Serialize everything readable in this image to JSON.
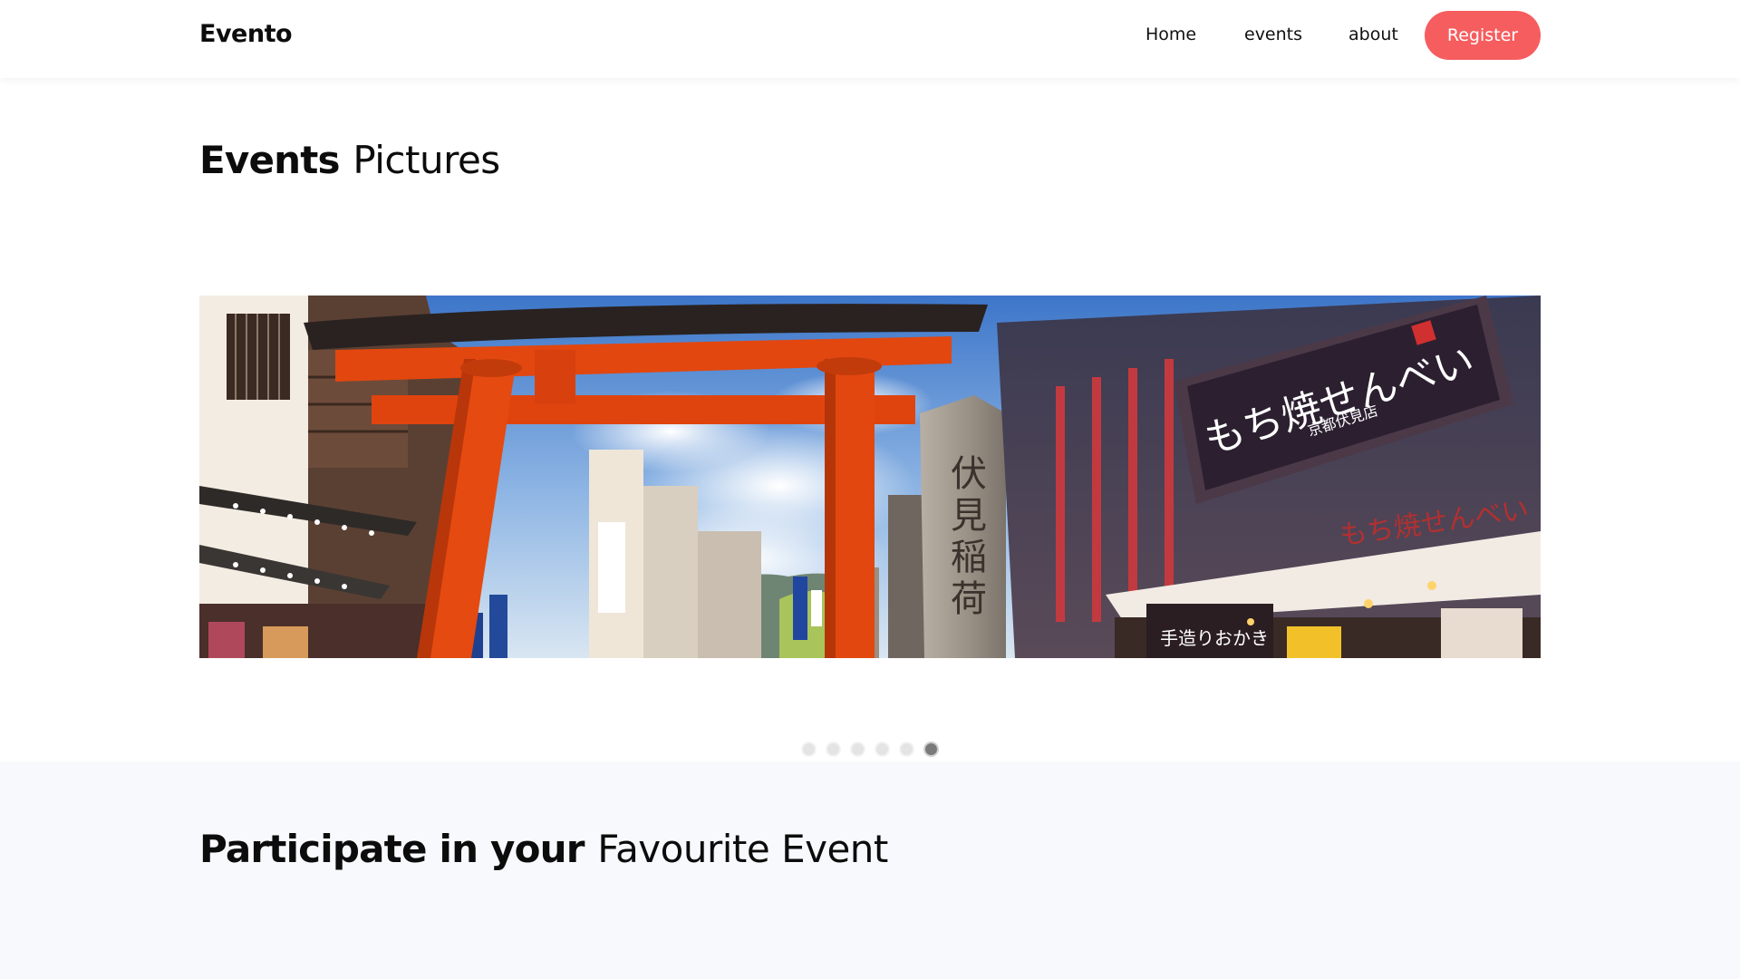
{
  "navbar": {
    "brand": "Evento",
    "links": [
      "Home",
      "events",
      "about"
    ],
    "register_label": "Register",
    "register_color": "#f65d5f"
  },
  "events_section": {
    "title_bold": "Events",
    "title_light": "Pictures"
  },
  "hero": {
    "sign_main": "もち焼せんべい",
    "sign_sub": "京都伏見店",
    "sign_small": "もち焼せんべい",
    "pillar_text": "伏見稲荷",
    "banner_text": "手造りおかき"
  },
  "carousel": {
    "slide_count": 6,
    "active_index": 5
  },
  "participate_section": {
    "title_bold": "Participate in your",
    "title_light": "Favourite Event"
  }
}
